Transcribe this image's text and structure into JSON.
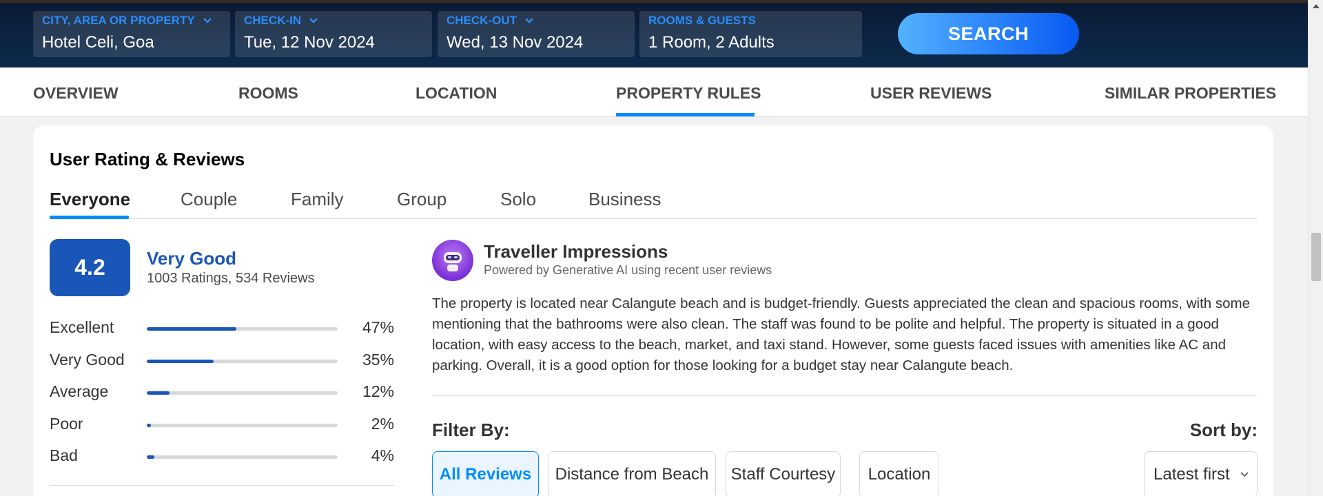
{
  "search": {
    "city": {
      "label": "CITY, AREA OR PROPERTY",
      "value": "Hotel Celi, Goa"
    },
    "checkin": {
      "label": "CHECK-IN",
      "value": "Tue, 12 Nov 2024"
    },
    "checkout": {
      "label": "CHECK-OUT",
      "value": "Wed, 13 Nov 2024"
    },
    "guests": {
      "label": "ROOMS & GUESTS",
      "value": "1 Room, 2 Adults"
    },
    "button_label": "SEARCH"
  },
  "nav": {
    "items": [
      {
        "label": "OVERVIEW"
      },
      {
        "label": "ROOMS"
      },
      {
        "label": "LOCATION"
      },
      {
        "label": "PROPERTY RULES",
        "active": true
      },
      {
        "label": "USER REVIEWS"
      },
      {
        "label": "SIMILAR PROPERTIES"
      }
    ]
  },
  "reviews": {
    "title": "User Rating & Reviews",
    "tabs": [
      {
        "label": "Everyone",
        "active": true
      },
      {
        "label": "Couple"
      },
      {
        "label": "Family"
      },
      {
        "label": "Group"
      },
      {
        "label": "Solo"
      },
      {
        "label": "Business"
      }
    ],
    "score": "4.2",
    "score_label": "Very Good",
    "score_summary": "1003 Ratings, 534 Reviews",
    "distribution": [
      {
        "label": "Excellent",
        "pct": "47%",
        "fraction": 0.47
      },
      {
        "label": "Very Good",
        "pct": "35%",
        "fraction": 0.35
      },
      {
        "label": "Average",
        "pct": "12%",
        "fraction": 0.12
      },
      {
        "label": "Poor",
        "pct": "2%",
        "fraction": 0.02
      },
      {
        "label": "Bad",
        "pct": "4%",
        "fraction": 0.04
      }
    ]
  },
  "impressions": {
    "title": "Traveller Impressions",
    "subtitle": "Powered by Generative AI using recent user reviews",
    "body": "The property is located near Calangute beach and is budget-friendly. Guests appreciated the clean and spacious rooms, with some mentioning that the bathrooms were also clean. The staff was found to be polite and helpful. The property is situated in a good location, with easy access to the beach, market, and taxi stand. However, some guests faced issues with amenities like AC and parking. Overall, it is a good option for those looking for a budget stay near Calangute beach."
  },
  "filters": {
    "label": "Filter By:",
    "chips": [
      {
        "label": "All Reviews",
        "active": true
      },
      {
        "label": "Distance from Beach"
      },
      {
        "label": "Staff Courtesy"
      },
      {
        "label": "Location"
      }
    ],
    "sort_label": "Sort by:",
    "sort_value": "Latest first"
  },
  "colors": {
    "header_bg": "#0a1a33",
    "accent_blue": "#008cff",
    "rating_blue": "#1a56b8"
  },
  "icons": {
    "dropdown": "chevron-down-icon",
    "ai_avatar": "robot-icon"
  }
}
